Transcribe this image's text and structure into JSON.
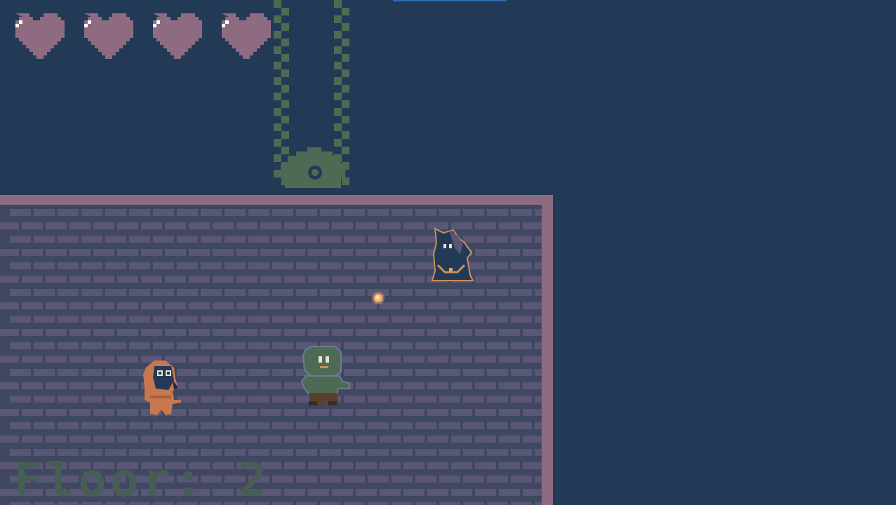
{
  "hud": {
    "hearts": [
      {
        "state": "full"
      },
      {
        "state": "full"
      },
      {
        "state": "full"
      },
      {
        "state": "full"
      }
    ],
    "floor_text": "Floor: 2"
  },
  "colors": {
    "background": "#233a57",
    "heart_fill": "#8e6b81",
    "wall_trim": "#8e6b81",
    "brick": "#5a5676",
    "mortar": "#3f4761",
    "chain": "#4f6a54",
    "floor_text": "#465e53"
  },
  "entities": {
    "player": {
      "sprite": "orange-hooded-player"
    },
    "enemy_wizard": {
      "sprite": "dark-hooded-wizard"
    },
    "zombie": {
      "sprite": "green-zombie"
    },
    "projectile": {
      "sprite": "fireball"
    },
    "door": {
      "sprite": "gear-gate"
    }
  }
}
